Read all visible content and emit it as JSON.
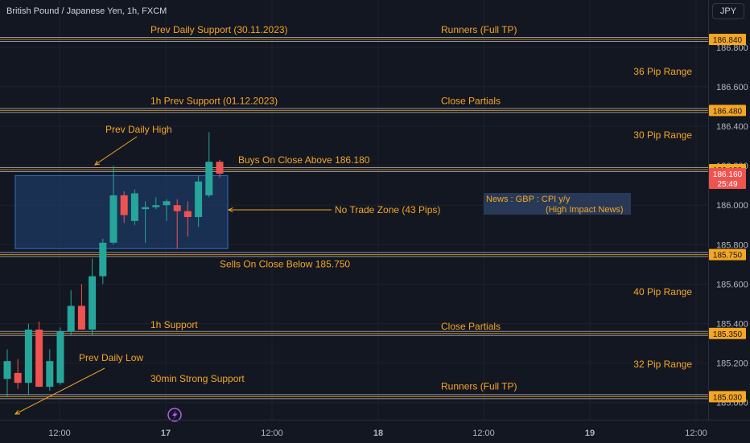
{
  "header": {
    "symbol_title": "British Pound / Japanese Yen, 1h, FXCM",
    "currency": "JPY"
  },
  "colors": {
    "background": "#131722",
    "up": "#26a69a",
    "down": "#ef5350",
    "annotation": "#f5a623",
    "zone_fill": "#1c3a64",
    "zone_border": "#2f6fc4",
    "grid": "#1e222d",
    "level_line": "#b2b5be"
  },
  "countdown": "25:49",
  "chart_data": {
    "type": "candlestick",
    "title": "British Pound / Japanese Yen, 1h, FXCM",
    "y_range": [
      184.95,
      186.95
    ],
    "y_ticks": [
      "186.800",
      "186.600",
      "186.400",
      "186.200",
      "186.000",
      "185.800",
      "185.600",
      "185.400",
      "185.200",
      "185.000"
    ],
    "x_ticks": [
      "12:00",
      "17",
      "12:00",
      "18",
      "12:00",
      "19",
      "12:00"
    ],
    "candles": [
      {
        "o": 185.12,
        "h": 185.27,
        "l": 185.03,
        "c": 185.21
      },
      {
        "o": 185.15,
        "h": 185.22,
        "l": 185.07,
        "c": 185.1
      },
      {
        "o": 185.1,
        "h": 185.4,
        "l": 185.04,
        "c": 185.37
      },
      {
        "o": 185.37,
        "h": 185.41,
        "l": 185.08,
        "c": 185.08
      },
      {
        "o": 185.08,
        "h": 185.27,
        "l": 185.06,
        "c": 185.21
      },
      {
        "o": 185.1,
        "h": 185.38,
        "l": 185.09,
        "c": 185.36
      },
      {
        "o": 185.36,
        "h": 185.57,
        "l": 185.34,
        "c": 185.49
      },
      {
        "o": 185.49,
        "h": 185.6,
        "l": 185.37,
        "c": 185.37
      },
      {
        "o": 185.37,
        "h": 185.73,
        "l": 185.34,
        "c": 185.64
      },
      {
        "o": 185.64,
        "h": 185.83,
        "l": 185.6,
        "c": 185.81
      },
      {
        "o": 185.81,
        "h": 186.2,
        "l": 185.8,
        "c": 186.05
      },
      {
        "o": 186.05,
        "h": 186.07,
        "l": 185.91,
        "c": 185.95
      },
      {
        "o": 185.92,
        "h": 186.08,
        "l": 185.9,
        "c": 186.06
      },
      {
        "o": 185.98,
        "h": 186.02,
        "l": 185.81,
        "c": 185.99
      },
      {
        "o": 185.99,
        "h": 186.04,
        "l": 185.98,
        "c": 186.0
      },
      {
        "o": 186.0,
        "h": 186.03,
        "l": 185.92,
        "c": 186.02
      },
      {
        "o": 186.0,
        "h": 186.03,
        "l": 185.78,
        "c": 185.97
      },
      {
        "o": 185.97,
        "h": 186.02,
        "l": 185.84,
        "c": 185.94
      },
      {
        "o": 185.94,
        "h": 186.15,
        "l": 185.89,
        "c": 186.12
      },
      {
        "o": 186.05,
        "h": 186.37,
        "l": 186.04,
        "c": 186.22
      },
      {
        "o": 186.22,
        "h": 186.23,
        "l": 186.14,
        "c": 186.16
      }
    ],
    "levels": [
      {
        "price": 186.84,
        "tag": "186.840"
      },
      {
        "price": 186.48,
        "tag": "186.480"
      },
      {
        "price": 186.18,
        "tag": "186.180"
      },
      {
        "price": 185.75,
        "tag": "185.750"
      },
      {
        "price": 185.35,
        "tag": "185.350"
      },
      {
        "price": 185.03,
        "tag": "185.030"
      }
    ],
    "current_price": {
      "price": 186.16,
      "tag": "186.160"
    },
    "annotations": {
      "prev_daily_support": "Prev Daily Support (30.11.2023)",
      "runners_top": "Runners (Full TP)",
      "range_36": "36 Pip Range",
      "h1_prev_support": "1h Prev Support (01.12.2023)",
      "close_partials_top": "Close Partials",
      "prev_daily_high": "Prev Daily High",
      "range_30": "30 Pip Range",
      "buys_on_close": "Buys On Close Above 186.180",
      "no_trade_zone": "No Trade Zone (43 Pips)",
      "news_line1": "News : GBP : CPI y/y",
      "news_line2": "(High Impact News)",
      "sells_on_close": "Sells On Close Below 185.750",
      "range_40": "40 Pip Range",
      "h1_support": "1h Support",
      "close_partials_bottom": "Close Partials",
      "prev_daily_low": "Prev Daily Low",
      "range_32": "32 Pip Range",
      "strong_support_30min": "30min Strong Support",
      "runners_bottom": "Runners (Full TP)"
    }
  }
}
